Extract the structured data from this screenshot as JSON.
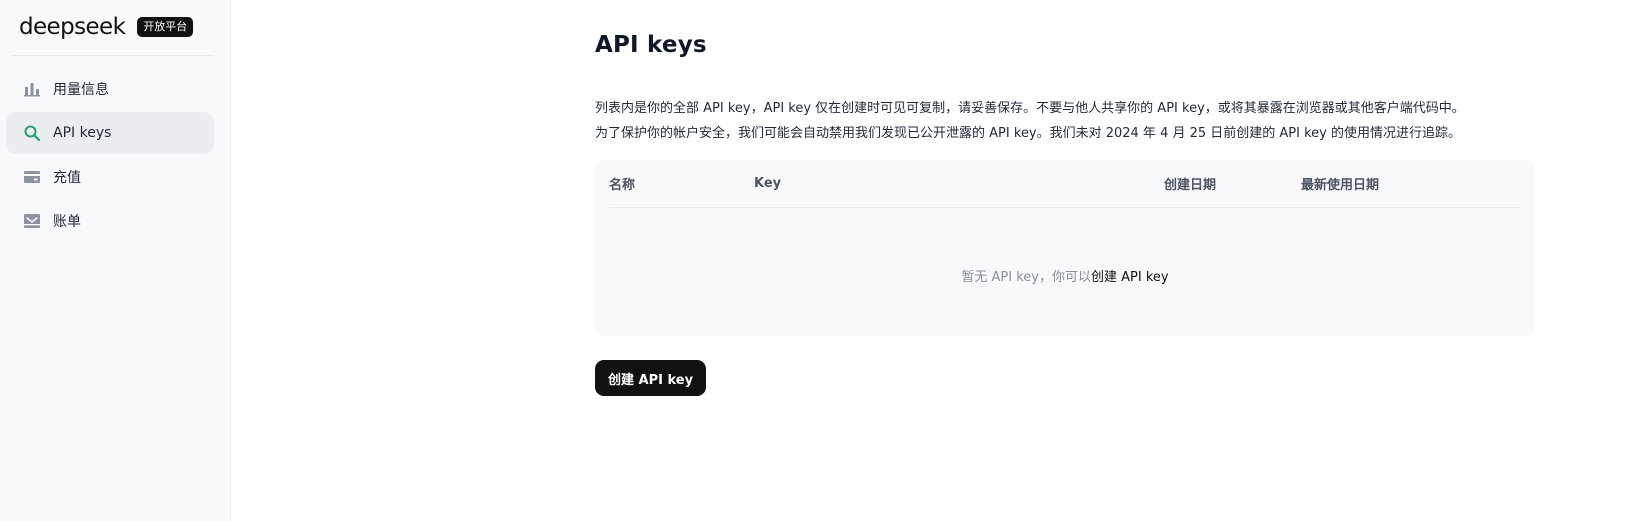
{
  "sidebar": {
    "logo": "deepseek",
    "badge": "开放平台",
    "items": [
      {
        "label": "用量信息",
        "icon": "bar-chart-icon",
        "active": false
      },
      {
        "label": "API keys",
        "icon": "key-search-icon",
        "active": true
      },
      {
        "label": "充值",
        "icon": "card-icon",
        "active": false
      },
      {
        "label": "账单",
        "icon": "bill-icon",
        "active": false
      }
    ]
  },
  "main": {
    "title": "API keys",
    "description_line1": "列表内是你的全部 API key，API key 仅在创建时可见可复制，请妥善保存。不要与他人共享你的 API key，或将其暴露在浏览器或其他客户端代码中。",
    "description_line2": "为了保护你的帐户安全，我们可能会自动禁用我们发现已公开泄露的 API key。我们未对 2024 年 4 月 25 日前创建的 API key 的使用情况进行追踪。",
    "table": {
      "columns": [
        "名称",
        "Key",
        "创建日期",
        "最新使用日期"
      ],
      "empty_text": "暂无 API key，你可以",
      "empty_link": "创建 API key"
    },
    "create_button": "创建 API key"
  },
  "colors": {
    "accent_icon": "#22a06b",
    "primary_button": "#111111",
    "sidebar_bg": "#f8f9fb",
    "active_item_bg": "#ebedf0"
  }
}
